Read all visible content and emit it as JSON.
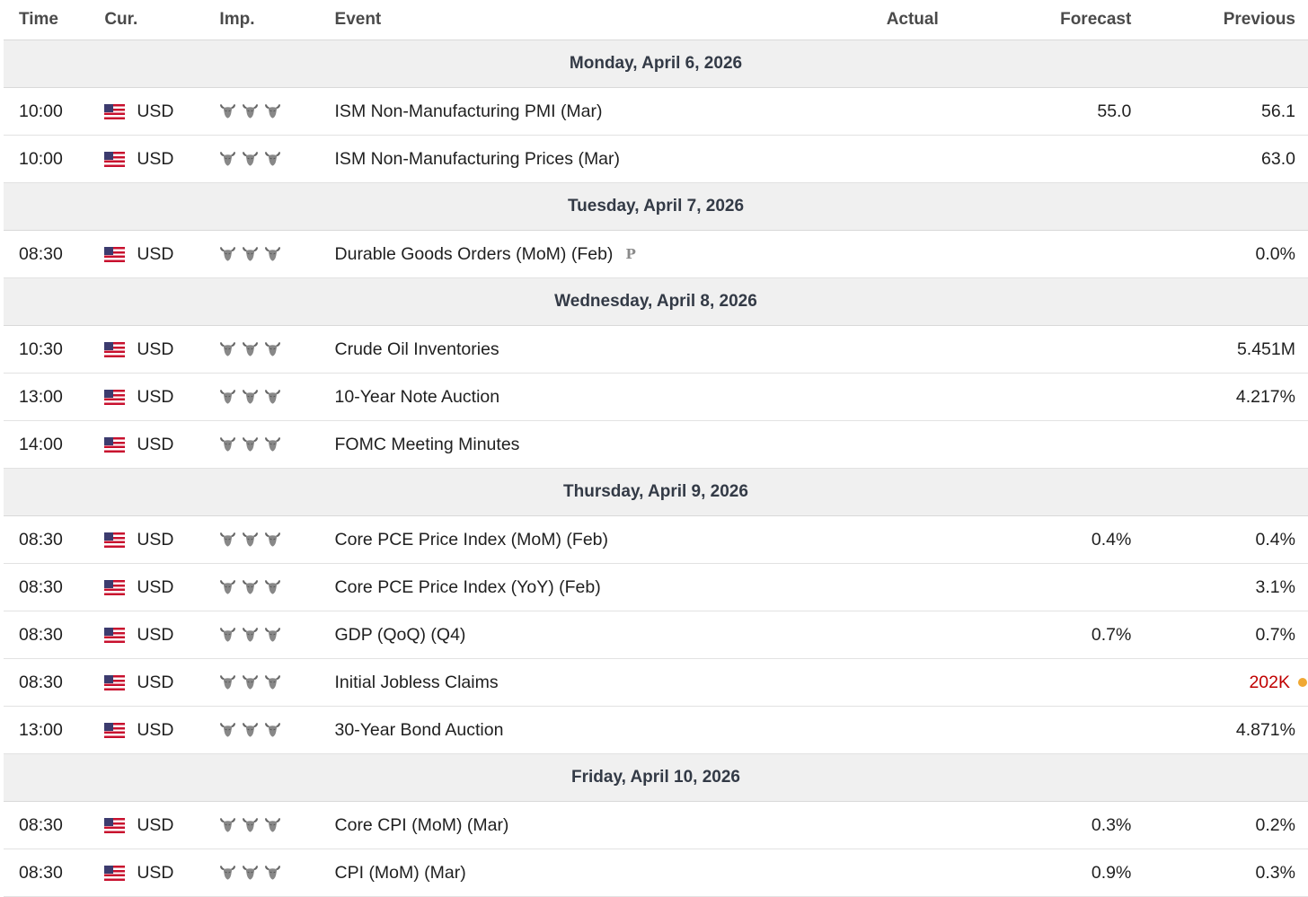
{
  "header": {
    "time": "Time",
    "cur": "Cur.",
    "imp": "Imp.",
    "event": "Event",
    "actual": "Actual",
    "forecast": "Forecast",
    "previous": "Previous"
  },
  "colors": {
    "highlight_red": "#c00000",
    "dot_orange": "#f0a833",
    "day_bg": "#f0f0f0"
  },
  "days": [
    {
      "label": "Monday, April 6, 2026",
      "events": [
        {
          "time": "10:00",
          "currency": "USD",
          "importance": 3,
          "event": "ISM Non-Manufacturing PMI (Mar)",
          "actual": "",
          "forecast": "55.0",
          "previous": "56.1"
        },
        {
          "time": "10:00",
          "currency": "USD",
          "importance": 3,
          "event": "ISM Non-Manufacturing Prices (Mar)",
          "actual": "",
          "forecast": "",
          "previous": "63.0"
        }
      ]
    },
    {
      "label": "Tuesday, April 7, 2026",
      "events": [
        {
          "time": "08:30",
          "currency": "USD",
          "importance": 3,
          "event": "Durable Goods Orders (MoM) (Feb)",
          "badge": "P",
          "actual": "",
          "forecast": "",
          "previous": "0.0%"
        }
      ]
    },
    {
      "label": "Wednesday, April 8, 2026",
      "events": [
        {
          "time": "10:30",
          "currency": "USD",
          "importance": 3,
          "event": "Crude Oil Inventories",
          "actual": "",
          "forecast": "",
          "previous": "5.451M"
        },
        {
          "time": "13:00",
          "currency": "USD",
          "importance": 3,
          "event": "10-Year Note Auction",
          "actual": "",
          "forecast": "",
          "previous": "4.217%"
        },
        {
          "time": "14:00",
          "currency": "USD",
          "importance": 3,
          "event": "FOMC Meeting Minutes",
          "actual": "",
          "forecast": "",
          "previous": ""
        }
      ]
    },
    {
      "label": "Thursday, April 9, 2026",
      "events": [
        {
          "time": "08:30",
          "currency": "USD",
          "importance": 3,
          "event": "Core PCE Price Index (MoM) (Feb)",
          "actual": "",
          "forecast": "0.4%",
          "previous": "0.4%"
        },
        {
          "time": "08:30",
          "currency": "USD",
          "importance": 3,
          "event": "Core PCE Price Index (YoY) (Feb)",
          "actual": "",
          "forecast": "",
          "previous": "3.1%"
        },
        {
          "time": "08:30",
          "currency": "USD",
          "importance": 3,
          "event": "GDP (QoQ) (Q4)",
          "actual": "",
          "forecast": "0.7%",
          "previous": "0.7%"
        },
        {
          "time": "08:30",
          "currency": "USD",
          "importance": 3,
          "event": "Initial Jobless Claims",
          "actual": "",
          "forecast": "",
          "previous": "202K",
          "previous_revised": true
        },
        {
          "time": "13:00",
          "currency": "USD",
          "importance": 3,
          "event": "30-Year Bond Auction",
          "actual": "",
          "forecast": "",
          "previous": "4.871%"
        }
      ]
    },
    {
      "label": "Friday, April 10, 2026",
      "events": [
        {
          "time": "08:30",
          "currency": "USD",
          "importance": 3,
          "event": "Core CPI (MoM) (Mar)",
          "actual": "",
          "forecast": "0.3%",
          "previous": "0.2%"
        },
        {
          "time": "08:30",
          "currency": "USD",
          "importance": 3,
          "event": "CPI (MoM) (Mar)",
          "actual": "",
          "forecast": "0.9%",
          "previous": "0.3%"
        }
      ]
    }
  ]
}
